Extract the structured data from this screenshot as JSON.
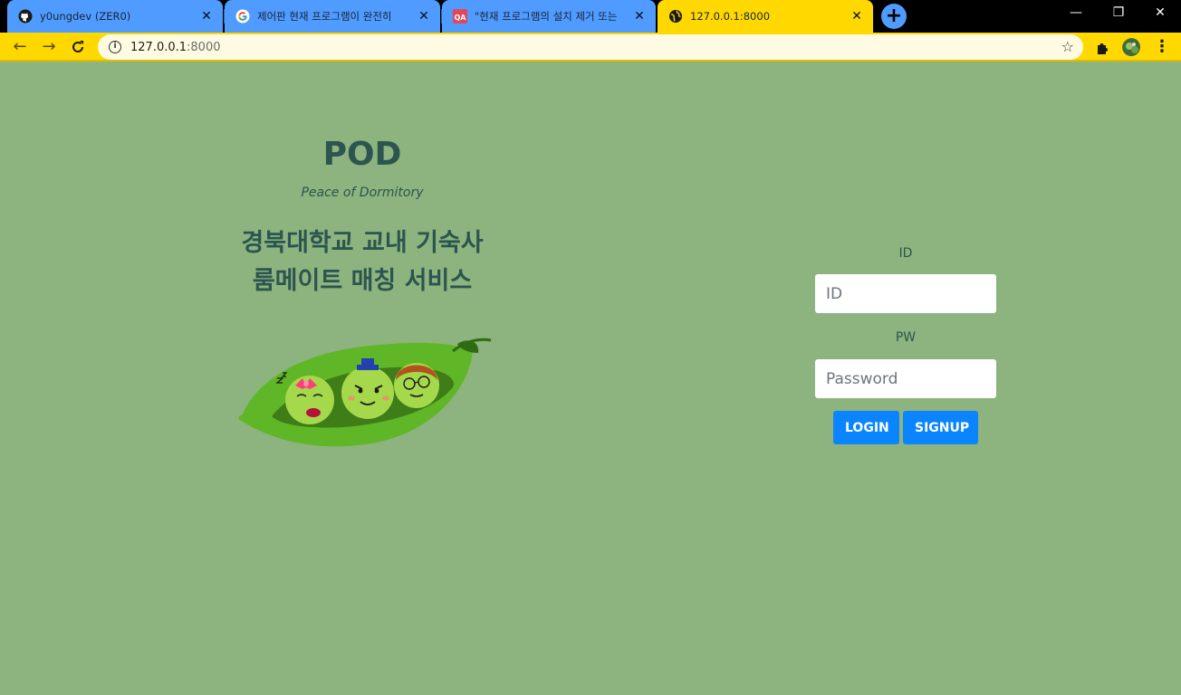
{
  "browser": {
    "tabs": [
      {
        "title": "y0ungdev (ZER0)",
        "icon": "github-icon",
        "active": false
      },
      {
        "title": "제어판 현재 프로그램이 완전히",
        "icon": "google-icon",
        "active": false
      },
      {
        "title": "\"현재 프로그램의 설치 제거 또는",
        "icon": "qa-icon",
        "icon_text": "QA",
        "active": false
      },
      {
        "title": "127.0.0.1:8000",
        "icon": "globe-icon",
        "active": true
      }
    ],
    "new_tab_label": "+",
    "url_host": "127.0.0.1",
    "url_port": ":8000",
    "accent_color": "#ffd800",
    "tab_color": "#4f9bff"
  },
  "page": {
    "background": "#8db37e",
    "brand": {
      "title": "POD",
      "subtitle": "Peace of Dormitory",
      "description_line1": "경북대학교 교내 기숙사",
      "description_line2": "룸메이트 매칭 서비스"
    },
    "login": {
      "id_label": "ID",
      "id_placeholder": "ID",
      "pw_label": "PW",
      "pw_placeholder": "Password",
      "login_button": "LOGIN",
      "signup_button": "SIGNUP",
      "button_color": "#0a84ff"
    }
  }
}
